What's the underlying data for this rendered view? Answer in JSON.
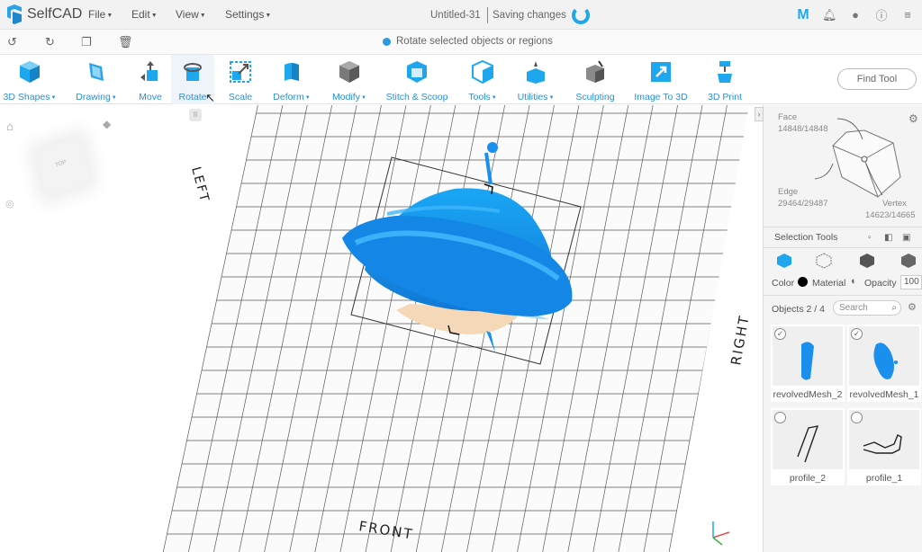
{
  "app": {
    "brand": "SelfCAD",
    "menus": [
      "File",
      "Edit",
      "View",
      "Settings"
    ],
    "doc_title": "Untitled-31",
    "save_status": "Saving changes",
    "account_badge": "M",
    "icons": [
      "bell-icon",
      "user-icon",
      "info-icon",
      "menu-icon"
    ]
  },
  "subbar": {
    "hint": "Rotate selected objects or regions",
    "controls": [
      "undo-icon",
      "redo-icon",
      "copy-icon",
      "delete-icon"
    ]
  },
  "ribbon": {
    "tools": [
      {
        "label": "3D Shapes",
        "dropdown": true
      },
      {
        "label": "Drawing",
        "dropdown": true
      },
      {
        "label": "Move",
        "dropdown": false
      },
      {
        "label": "Rotate",
        "dropdown": false,
        "active": true
      },
      {
        "label": "Scale",
        "dropdown": false
      },
      {
        "label": "Deform",
        "dropdown": true
      },
      {
        "label": "Modify",
        "dropdown": true
      },
      {
        "label": "Stitch & Scoop",
        "dropdown": false
      },
      {
        "label": "Tools",
        "dropdown": true
      },
      {
        "label": "Utilities",
        "dropdown": true
      },
      {
        "label": "Sculpting",
        "dropdown": false
      },
      {
        "label": "Image To 3D",
        "dropdown": false
      },
      {
        "label": "3D Print",
        "dropdown": false
      }
    ],
    "find_tool": "Find Tool"
  },
  "viewport": {
    "labels": {
      "left": "LEFT",
      "right": "RIGHT",
      "front": "FRONT",
      "cube": "TOP"
    }
  },
  "panel": {
    "face_label": "Face",
    "face_count": "14848/14848",
    "edge_label": "Edge",
    "edge_count": "29464/29487",
    "vertex_label": "Vertex",
    "vertex_count": "14623/14665",
    "selection_tools": "Selection Tools",
    "color_label": "Color",
    "material_label": "Material",
    "opacity_label": "Opacity",
    "opacity_value": "100",
    "objects_label": "Objects 2 / 4",
    "search_placeholder": "Search",
    "objects": [
      {
        "name": "revolvedMesh_2",
        "checked": true
      },
      {
        "name": "revolvedMesh_1",
        "checked": true
      },
      {
        "name": "profile_2",
        "checked": false
      },
      {
        "name": "profile_1",
        "checked": false
      }
    ]
  },
  "colors": {
    "accent": "#1ea7ef",
    "model_blue": "#1a8fee",
    "label_blue": "#2a90d8"
  }
}
